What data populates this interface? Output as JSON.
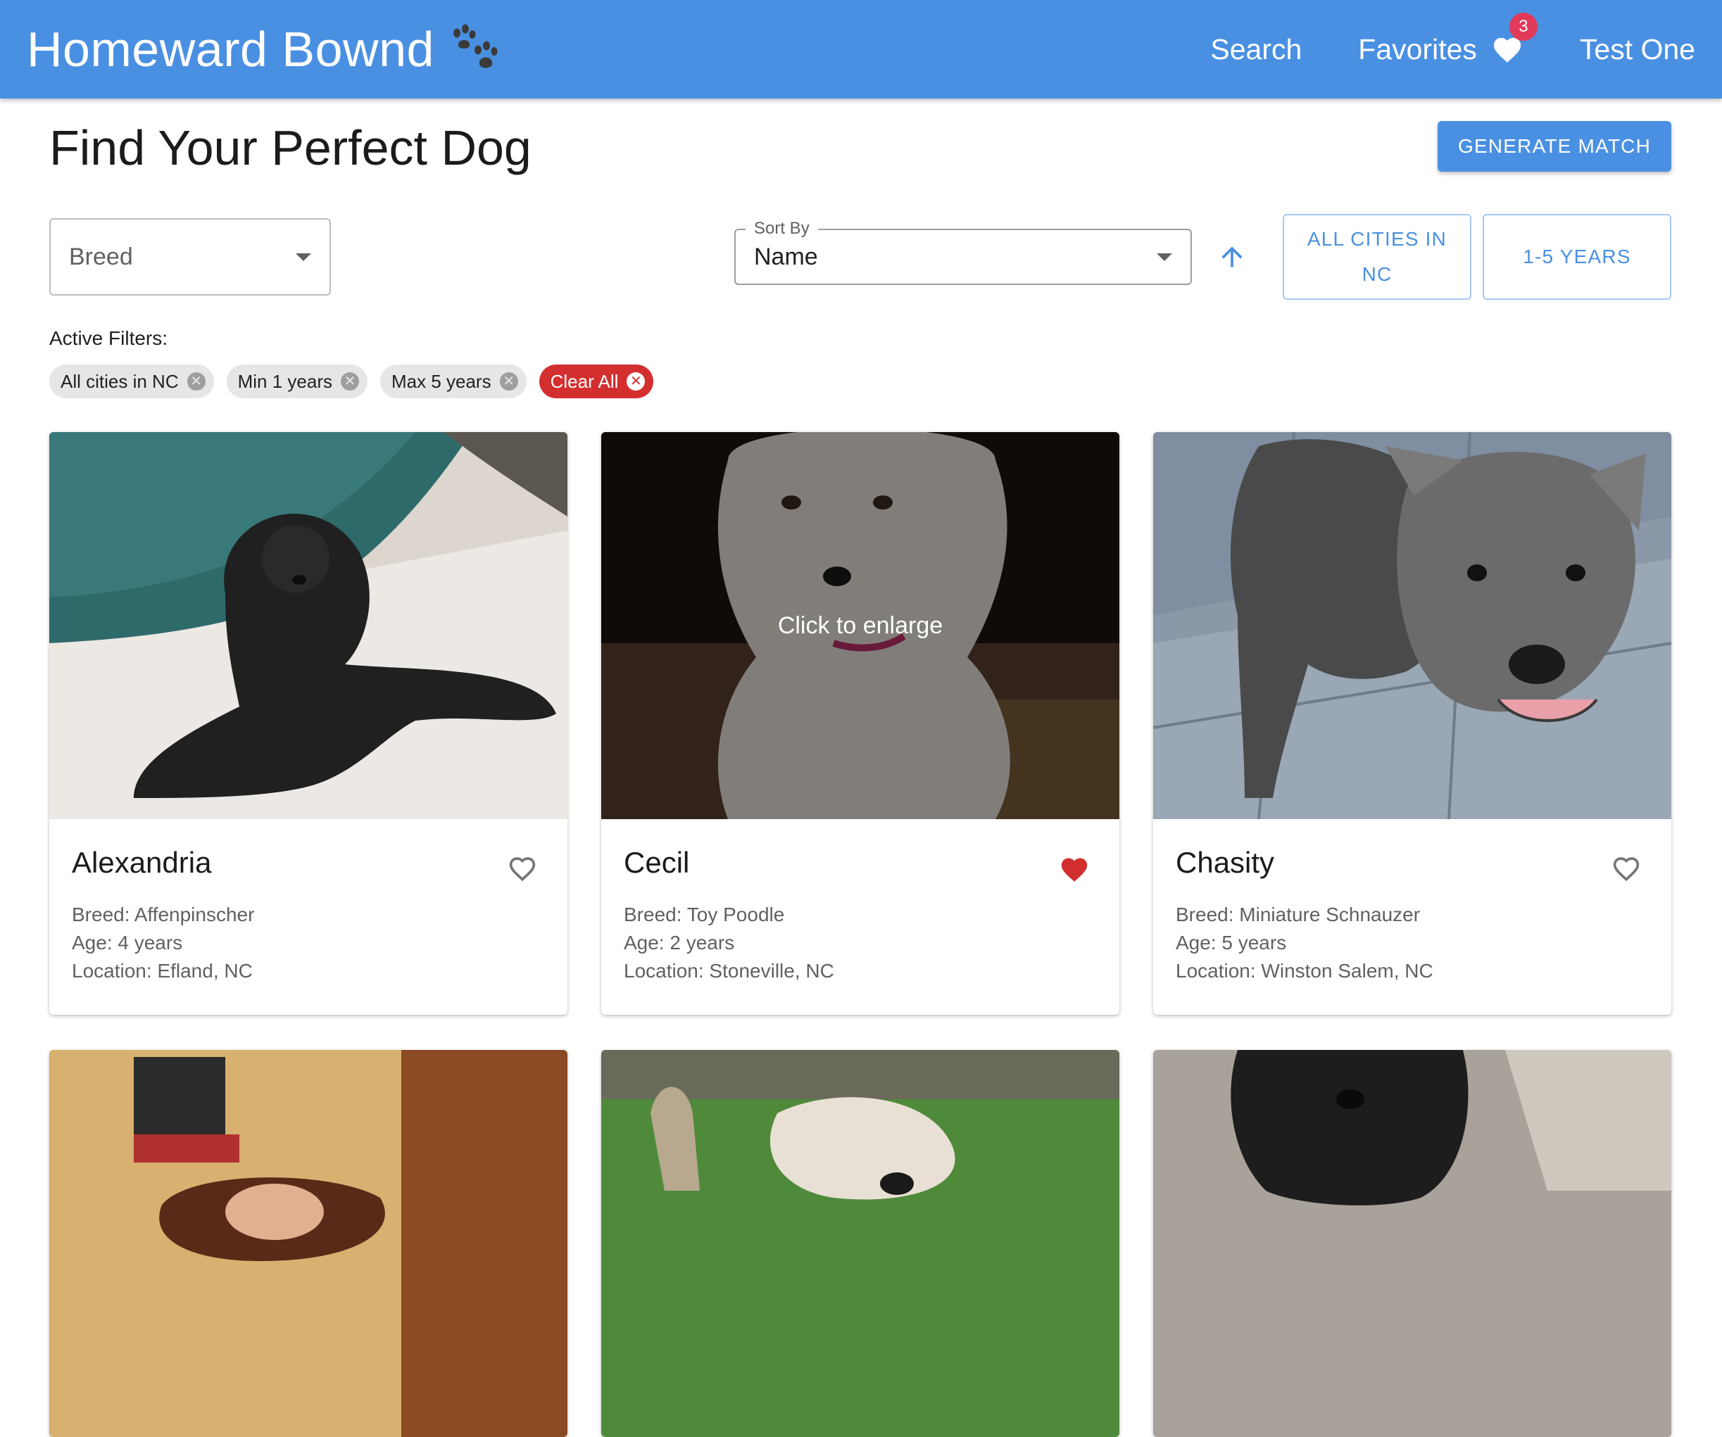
{
  "header": {
    "brand": "Homeward Bownd",
    "nav": {
      "search": "Search",
      "favorites": "Favorites",
      "favorites_count": "3",
      "user": "Test One"
    }
  },
  "main": {
    "title": "Find Your Perfect Dog",
    "generate_button": "GENERATE MATCH",
    "breed_select": {
      "placeholder": "Breed"
    },
    "sort": {
      "label": "Sort By",
      "value": "Name",
      "direction": "ascending"
    },
    "location_button": "ALL CITIES IN NC",
    "age_button": "1-5 YEARS",
    "active_filters_label": "Active Filters:",
    "chips": [
      "All cities in NC",
      "Min 1 years",
      "Max 5 years"
    ],
    "clear_all": "Clear All"
  },
  "dogs": [
    {
      "name": "Alexandria",
      "breed": "Breed: Affenpinscher",
      "age": "Age: 4 years",
      "location": "Location: Efland, NC",
      "favorite": false
    },
    {
      "name": "Cecil",
      "breed": "Breed: Toy Poodle",
      "age": "Age: 2 years",
      "location": "Location: Stoneville, NC",
      "favorite": true,
      "overlay": "Click to enlarge"
    },
    {
      "name": "Chasity",
      "breed": "Breed: Miniature Schnauzer",
      "age": "Age: 5 years",
      "location": "Location: Winston Salem, NC",
      "favorite": false
    }
  ],
  "colors": {
    "primary": "#4a90e2",
    "danger": "#d32f2f",
    "favorite_heart": "#d32f2f",
    "badge": "#e23a5a"
  }
}
